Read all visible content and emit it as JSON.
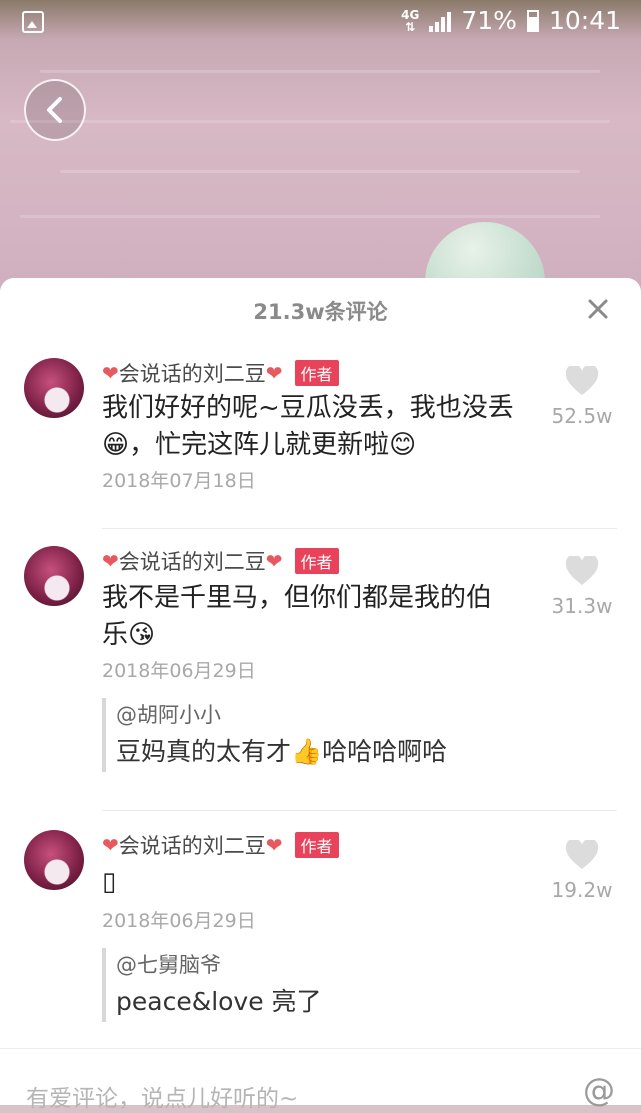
{
  "status_bar": {
    "network": "4G",
    "battery_percent": "71%",
    "time": "10:41"
  },
  "sheet": {
    "title": "21.3w条评论",
    "close_icon": "close-icon"
  },
  "comments": [
    {
      "author": "会说话的刘二豆",
      "tag": "作者",
      "text": "我们好好的呢~豆瓜没丢，我也没丢😁，忙完这阵儿就更新啦😊",
      "date": "2018年07月18日",
      "likes": "52.5w"
    },
    {
      "author": "会说话的刘二豆",
      "tag": "作者",
      "text": "我不是千里马，但你们都是我的伯乐😘",
      "date": "2018年06月29日",
      "likes": "31.3w",
      "reply": {
        "name": "@胡阿小小",
        "text": "豆妈真的太有才👍哈哈哈啊哈"
      }
    },
    {
      "author": "会说话的刘二豆",
      "tag": "作者",
      "text": "▯",
      "date": "2018年06月29日",
      "likes": "19.2w",
      "reply": {
        "name": "@七舅脑爷",
        "text": "peace&love 亮了"
      }
    }
  ],
  "input": {
    "placeholder": "有爱评论，说点儿好听的~"
  }
}
